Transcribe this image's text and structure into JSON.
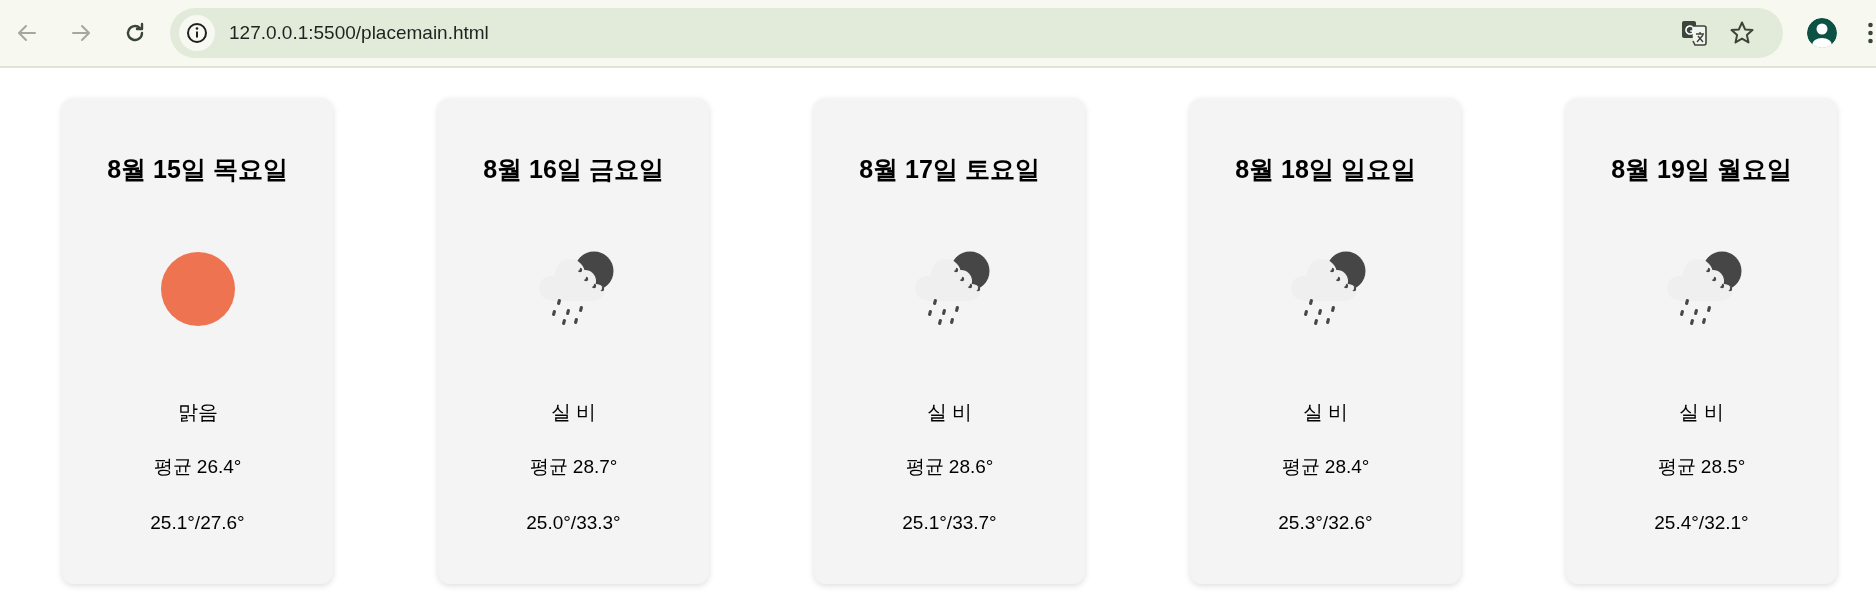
{
  "browser": {
    "nav_buttons": [
      {
        "kind": "back",
        "disabled": true
      },
      {
        "kind": "forward",
        "disabled": true
      },
      {
        "kind": "reload",
        "disabled": false
      }
    ],
    "url": "127.0.0.1:5500/placemain.html"
  },
  "forecast": [
    {
      "date": "8월 15일 목요일",
      "kind": "clear",
      "condition": "맑음",
      "average": "평균 26.4°",
      "range": "25.1°/27.6°"
    },
    {
      "date": "8월 16일 금요일",
      "kind": "rain-night",
      "condition": "실 비",
      "average": "평균 28.7°",
      "range": "25.0°/33.3°"
    },
    {
      "date": "8월 17일 토요일",
      "kind": "rain-night",
      "condition": "실 비",
      "average": "평균 28.6°",
      "range": "25.1°/33.7°"
    },
    {
      "date": "8월 18일 일요일",
      "kind": "rain-night",
      "condition": "실 비",
      "average": "평균 28.4°",
      "range": "25.3°/32.6°"
    },
    {
      "date": "8월 19일 월요일",
      "kind": "rain-night",
      "condition": "실 비",
      "average": "평균 28.5°",
      "range": "25.4°/32.1°"
    }
  ]
}
